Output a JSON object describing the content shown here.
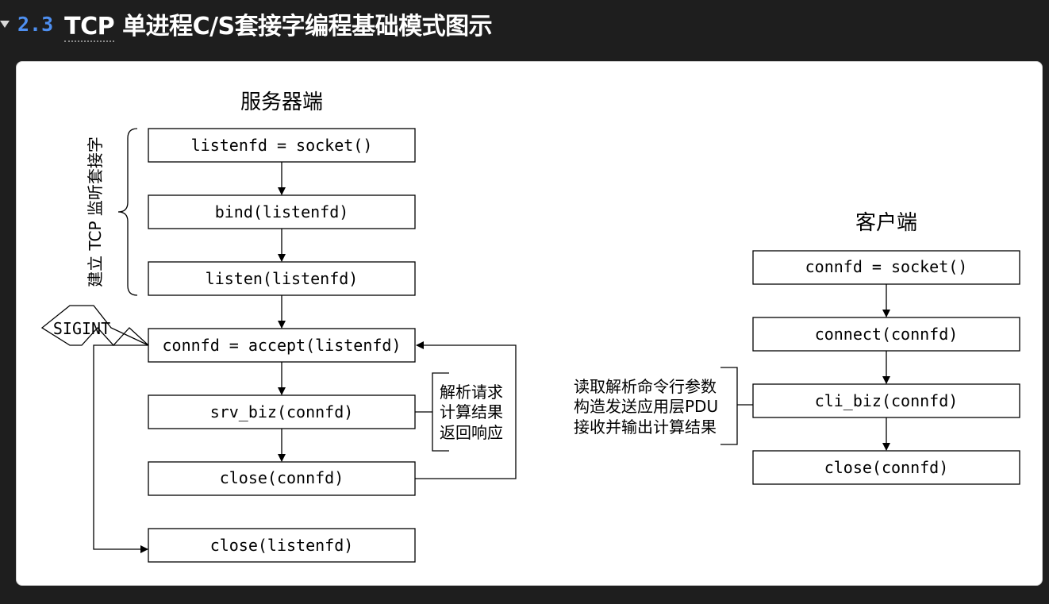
{
  "heading": {
    "number": "2.3",
    "title_tcp": "TCP",
    "title_rest": " 单进程C/S套接字编程基础模式图示"
  },
  "diagram": {
    "server_title": "服务器端",
    "client_title": "客户端",
    "server_boxes": [
      "listenfd = socket()",
      "bind(listenfd)",
      "listen(listenfd)",
      "connfd = accept(listenfd)",
      "srv_biz(connfd)",
      "close(connfd)",
      "close(listenfd)"
    ],
    "client_boxes": [
      "connfd = socket()",
      "connect(connfd)",
      "cli_biz(connfd)",
      "close(connfd)"
    ],
    "server_side_label": "建立 TCP 监听套接字",
    "signal_label": "SIGINT",
    "srv_notes": [
      "解析请求",
      "计算结果",
      "返回响应"
    ],
    "cli_notes": [
      "读取解析命令行参数",
      "构造发送应用层PDU",
      "接收并输出计算结果"
    ]
  }
}
